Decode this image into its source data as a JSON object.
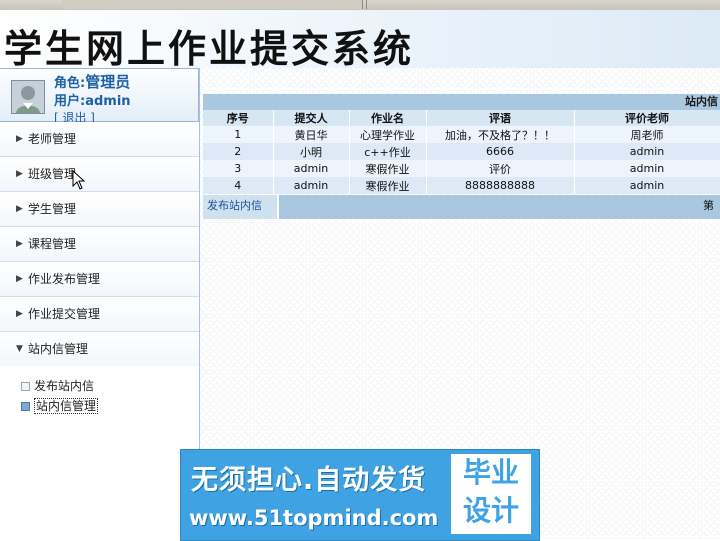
{
  "header": {
    "title": "学生网上作业提交系统"
  },
  "user": {
    "role_label": "角色:",
    "role_value": "管理员",
    "user_label": "用户:",
    "user_value": "admin",
    "logout": "[ 退出 ]"
  },
  "sidebar": {
    "items": [
      {
        "label": "老师管理"
      },
      {
        "label": "班级管理"
      },
      {
        "label": "学生管理"
      },
      {
        "label": "课程管理"
      },
      {
        "label": "作业发布管理"
      },
      {
        "label": "作业提交管理"
      },
      {
        "label": "站内信管理"
      }
    ],
    "sub_items": [
      {
        "label": "发布站内信"
      },
      {
        "label": "站内信管理"
      }
    ]
  },
  "panel": {
    "title": "站内信",
    "columns": [
      "序号",
      "提交人",
      "作业名",
      "评语",
      "评价老师"
    ],
    "rows": [
      [
        "1",
        "黄日华",
        "心理学作业",
        "加油，不及格了？！！",
        "周老师"
      ],
      [
        "2",
        "小明",
        "c++作业",
        "6666",
        "admin"
      ],
      [
        "3",
        "admin",
        "寒假作业",
        "评价",
        "admin"
      ],
      [
        "4",
        "admin",
        "寒假作业",
        "8888888888",
        "admin"
      ]
    ],
    "footer_link": "发布站内信",
    "footer_page": "第"
  },
  "watermark": {
    "line1": "无须担心.自动发货",
    "line2": "www.51topmind.com",
    "badge_top": "毕业",
    "badge_bottom": "设计"
  }
}
